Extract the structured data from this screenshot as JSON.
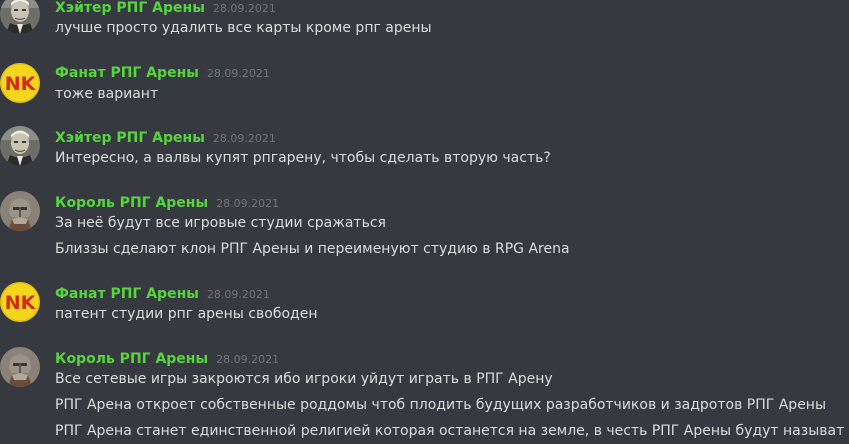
{
  "messages": [
    {
      "author": "Хэйтер РПГ Арены",
      "avatar": "old-man-avatar",
      "time": "28.09.2021",
      "lines": [
        "лучше просто удалить все карты кроме рпг арены"
      ]
    },
    {
      "author": "Фанат РПГ Арены",
      "avatar": "nk-logo-avatar",
      "avatar_text": "NK",
      "time": "28.09.2021",
      "lines": [
        "тоже вариант"
      ]
    },
    {
      "author": "Хэйтер РПГ Арены",
      "avatar": "old-man-avatar",
      "time": "28.09.2021",
      "lines": [
        "Интересно, а валвы купят рпгарену, чтобы сделать вторую часть?"
      ]
    },
    {
      "author": "Король РПГ Арены",
      "avatar": "helmet-warrior-avatar",
      "time": "28.09.2021",
      "lines": [
        "За неё будут все игровые студии сражаться",
        "Близзы сделают клон РПГ Арены и переименуют студию в RPG Arena"
      ]
    },
    {
      "author": "Фанат РПГ Арены",
      "avatar": "nk-logo-avatar",
      "avatar_text": "NK",
      "time": "28.09.2021",
      "lines": [
        "патент студии рпг арены свободен"
      ]
    },
    {
      "author": "Король РПГ Арены",
      "avatar": "helmet-warrior-avatar",
      "time": "28.09.2021",
      "lines": [
        "Все сетевые игры закроются ибо игроки уйдут играть в РПГ Арену",
        "РПГ Арена откроет собственные роддомы чтоб плодить будущих разработчиков и задротов РПГ Арены",
        "РПГ Арена станет единственной религией которая останется на земле, в честь РПГ Арены будут называть детей"
      ]
    }
  ],
  "colors": {
    "background": "#36393f",
    "username": "#56d63c",
    "timestamp": "#72767d",
    "text": "#dcddde",
    "nk_yellow": "#f2d21a",
    "nk_red": "#d8281c"
  }
}
